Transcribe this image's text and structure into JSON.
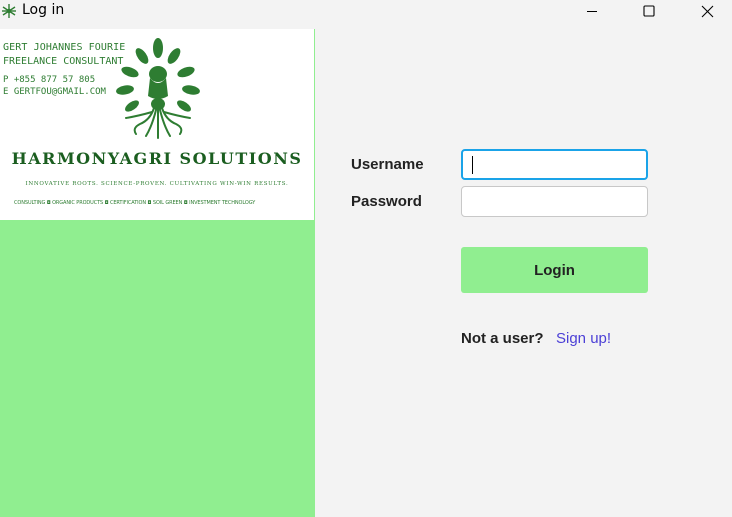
{
  "window": {
    "title": "Log in",
    "controls": {
      "minimize": "minimize",
      "maximize": "maximize",
      "close": "close"
    }
  },
  "card": {
    "name": "GERT JOHANNES FOURIE",
    "title": "FREELANCE CONSULTANT",
    "phone": "P  +855 877 57 805",
    "email": "E  GERTFOU@GMAIL.COM",
    "company": "HARMONYAGRI SOLUTIONS",
    "tagline": "INNOVATIVE ROOTS. SCIENCE-PROVEN. CULTIVATING WIN-WIN RESULTS.",
    "services": "CONSULTING ◘ ORGANIC PRODUCTS ◘ CERTIFICATION ◘ SOIL GREEN ◘ INVESTMENT TECHNOLOGY",
    "logo_icon": "tree-of-life-icon"
  },
  "form": {
    "username_label": "Username",
    "username_value": "",
    "password_label": "Password",
    "password_value": "",
    "login_label": "Login",
    "not_user_text": "Not a user?",
    "signup_text": "Sign up!"
  },
  "colors": {
    "accent_green": "#90ee90",
    "brand_dark_green": "#2e7d32",
    "focus_blue": "#1aa3e8",
    "link": "#4b3fd6"
  }
}
